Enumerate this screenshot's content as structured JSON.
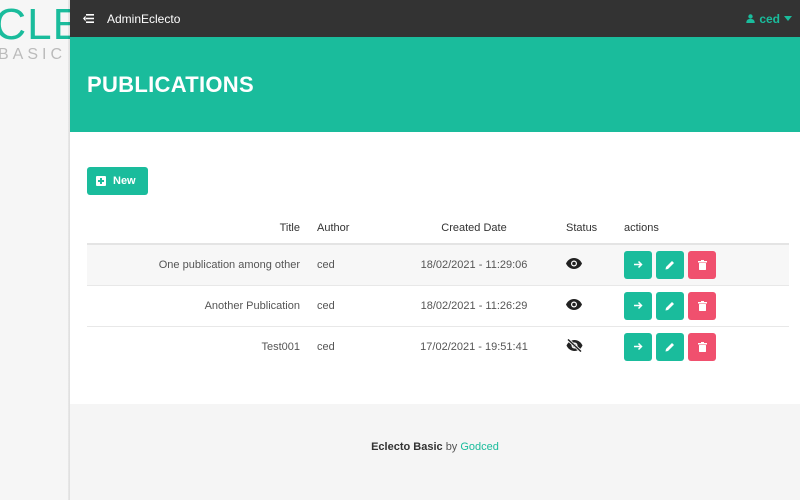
{
  "sidebar": {
    "logo_main": "ECLECTO",
    "logo_sub": "BASIC"
  },
  "topbar": {
    "app_title": "AdminEclecto",
    "user": "ced"
  },
  "banner": {
    "title": "PUBLICATIONS"
  },
  "toolbar": {
    "new_label": "New"
  },
  "table": {
    "headers": {
      "title": "Title",
      "author": "Author",
      "created": "Created Date",
      "status": "Status",
      "actions": "actions"
    },
    "rows": [
      {
        "title": "One publication among other",
        "author": "ced",
        "created": "18/02/2021 - 11:29:06",
        "status": "visible"
      },
      {
        "title": "Another Publication",
        "author": "ced",
        "created": "18/02/2021 - 11:26:29",
        "status": "visible"
      },
      {
        "title": "Test001",
        "author": "ced",
        "created": "17/02/2021 - 19:51:41",
        "status": "hidden"
      }
    ]
  },
  "footer": {
    "brand": "Eclecto Basic",
    "by": "by",
    "author": "Godced"
  },
  "colors": {
    "accent": "#1abc9c",
    "danger": "#f0506e",
    "topbar": "#333333"
  }
}
